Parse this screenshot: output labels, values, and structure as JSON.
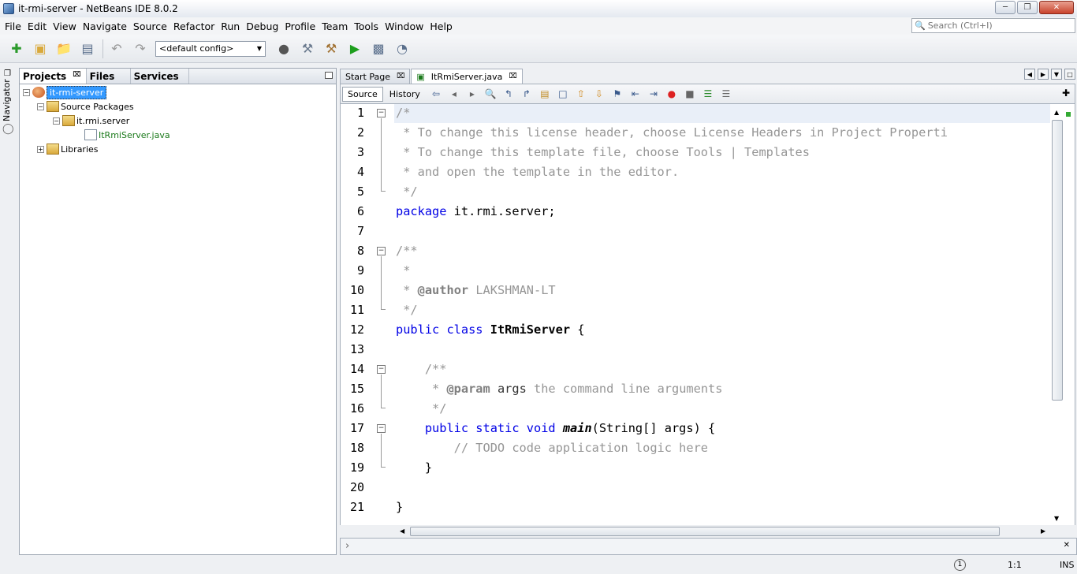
{
  "window": {
    "title": "it-rmi-server - NetBeans IDE 8.0.2"
  },
  "menu": [
    "File",
    "Edit",
    "View",
    "Navigate",
    "Source",
    "Refactor",
    "Run",
    "Debug",
    "Profile",
    "Team",
    "Tools",
    "Window",
    "Help"
  ],
  "search": {
    "placeholder": "Search (Ctrl+I)"
  },
  "toolbar": {
    "config": "<default config>"
  },
  "navigator": {
    "label": "Navigator"
  },
  "panel": {
    "tabs": [
      "Projects",
      "Files",
      "Services"
    ],
    "tree": {
      "project": "it-rmi-server",
      "source_packages": "Source Packages",
      "package": "it.rmi.server",
      "file": "ItRmiServer.java",
      "libraries": "Libraries"
    }
  },
  "editor": {
    "tabs": [
      "Start Page",
      "ItRmiServer.java"
    ],
    "source_label": "Source",
    "history_label": "History",
    "line_numbers": [
      "1",
      "2",
      "3",
      "4",
      "5",
      "6",
      "7",
      "8",
      "9",
      "10",
      "11",
      "12",
      "13",
      "14",
      "15",
      "16",
      "17",
      "18",
      "19",
      "20",
      "21"
    ],
    "code": {
      "l1": "/*",
      "l2": " * To change this license header, choose License Headers in Project Properti",
      "l3": " * To change this template file, choose Tools | Templates",
      "l4": " * and open the template in the editor.",
      "l5": " */",
      "l6_kw": "package",
      "l6_rest": " it.rmi.server;",
      "l8": "/**",
      "l9": " *",
      "l10_pre": " * ",
      "l10_tag": "@author",
      "l10_rest": " LAKSHMAN-LT",
      "l11": " */",
      "l12_kw": "public class ",
      "l12_name": "ItRmiServer",
      "l12_rest": " {",
      "l14": "    /**",
      "l15_pre": "     * ",
      "l15_tag": "@param",
      "l15_arg": " args",
      "l15_rest": " the command line arguments",
      "l16": "     */",
      "l17_kw": "    public static void ",
      "l17_name": "main",
      "l17_rest": "(String[] args) {",
      "l18": "        // TODO code application logic here",
      "l19": "    }",
      "l21": "}"
    }
  },
  "status": {
    "position": "1:1",
    "mode": "INS"
  }
}
